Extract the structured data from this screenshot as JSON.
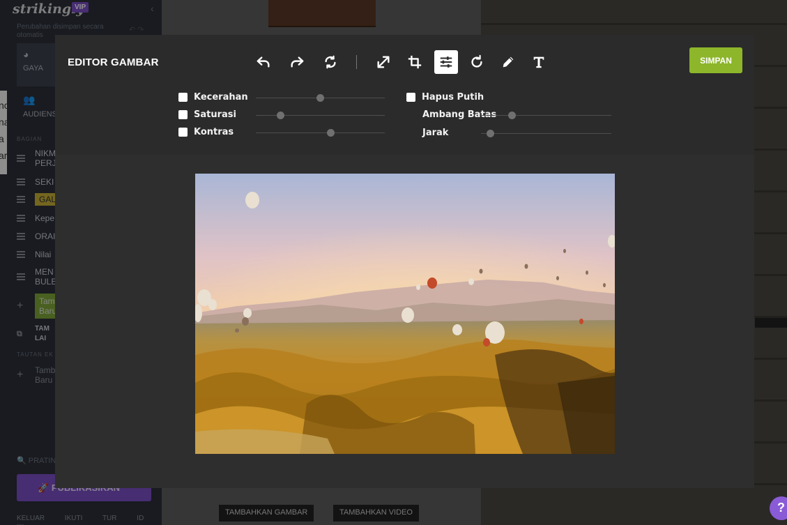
{
  "background_app": {
    "logo": "strikingly",
    "badge": "VIP",
    "autosave_note": "Perubahan disimpan secara otomatis",
    "tabs": [
      {
        "label": "GAYA",
        "icon": "palette-icon"
      },
      {
        "label": "AUDIENS",
        "icon": "users-icon"
      }
    ],
    "sections_header": "BAGIAN",
    "sections": [
      "NIKM PERJ",
      "SEKI",
      "GALE",
      "Kepe",
      "ORAI",
      "Nilai",
      "MEN BULE"
    ],
    "add_section": "Tamb Baru",
    "add_layout": "TAM LAI",
    "links_header": "TAUTAN EK",
    "add_link": "Tamb Baru",
    "preview": "PRATIN",
    "publish": "PUBLIKASIKAN",
    "footer_items": [
      "KELUAR",
      "IKUTI TUR",
      "ID",
      "•••"
    ],
    "page_buttons": [
      "TAMBAHKAN GAMBAR",
      "TAMBAHKAN VIDEO"
    ],
    "left_page_text": [
      "nc",
      "na",
      "a",
      "ar"
    ],
    "left_edge_text": "a",
    "help": "?"
  },
  "editor": {
    "title": "EDITOR GAMBAR",
    "tools": [
      {
        "name": "undo-icon",
        "active": false
      },
      {
        "name": "redo-icon",
        "active": false
      },
      {
        "name": "reset-icon",
        "active": false
      },
      {
        "name": "resize-icon",
        "active": false
      },
      {
        "name": "crop-icon",
        "active": false
      },
      {
        "name": "adjust-icon",
        "active": true
      },
      {
        "name": "rotate-icon",
        "active": false
      },
      {
        "name": "draw-icon",
        "active": false
      },
      {
        "name": "text-icon",
        "active": false
      }
    ],
    "save_label": "SIMPAN",
    "accent_color": "#8db62b",
    "adjustments": {
      "brightness": {
        "label": "Kecerahan",
        "checked": false,
        "value": 0.5
      },
      "saturation": {
        "label": "Saturasi",
        "checked": false,
        "value": 0.19
      },
      "contrast": {
        "label": "Kontras",
        "checked": false,
        "value": 0.58
      },
      "remove_white": {
        "label": "Hapus Putih",
        "checked": false
      },
      "threshold": {
        "label": "Ambang Batas",
        "value": 0.24
      },
      "distance": {
        "label": "Jarak",
        "value": 0.07
      }
    }
  }
}
